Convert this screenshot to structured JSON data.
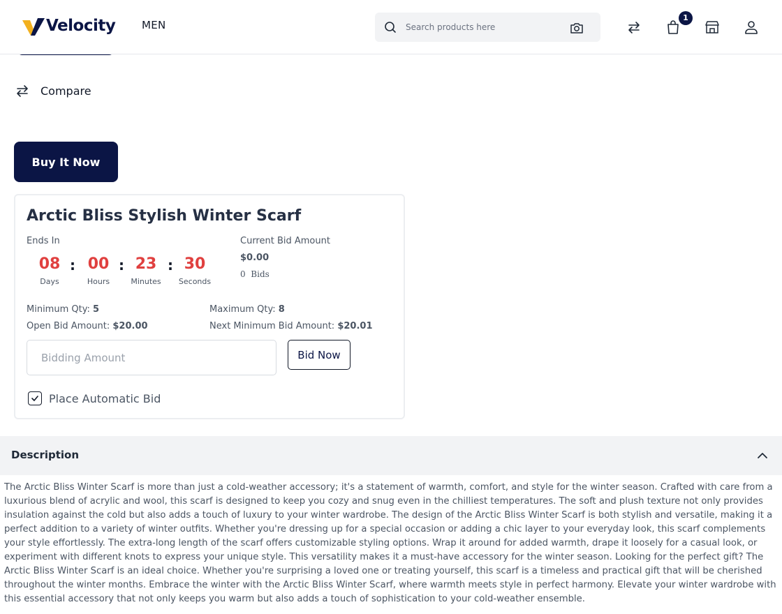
{
  "header": {
    "logo_text": "Velocity",
    "nav_men": "MEN",
    "search_placeholder": "Search products here",
    "cart_count": "1"
  },
  "actions": {
    "compare_label": "Compare",
    "buy_now_label": "Buy It Now"
  },
  "auction": {
    "title": "Arctic Bliss Stylish Winter Scarf",
    "ends_in_label": "Ends In",
    "countdown": [
      {
        "value": "08",
        "unit": "Days"
      },
      {
        "value": "00",
        "unit": "Hours"
      },
      {
        "value": "23",
        "unit": "Minutes"
      },
      {
        "value": "30",
        "unit": "Seconds"
      }
    ],
    "colon": ":",
    "current_bid_label": "Current Bid Amount",
    "current_bid_value": "$0.00",
    "bids_count": "0",
    "bids_label": "Bids",
    "min_qty_label": "Minimum Qty:",
    "min_qty_value": "5",
    "max_qty_label": "Maximum Qty:",
    "max_qty_value": "8",
    "open_bid_label": "Open Bid Amount:",
    "open_bid_value": "$20.00",
    "next_min_bid_label": "Next Minimum Bid Amount:",
    "next_min_bid_value": "$20.01",
    "bid_input_placeholder": "Bidding Amount",
    "bid_now_label": "Bid Now",
    "auto_bid_label": "Place Automatic Bid"
  },
  "description": {
    "title": "Description",
    "text": "The Arctic Bliss Winter Scarf is more than just a cold-weather accessory; it's a statement of warmth, comfort, and style for the winter season. Crafted with care from a luxurious blend of acrylic and wool, this scarf is designed to keep you cozy and snug even in the chilliest temperatures. The soft and plush texture not only provides insulation against the cold but also adds a touch of luxury to your winter wardrobe. The design of the Arctic Bliss Winter Scarf is both stylish and versatile, making it a perfect addition to a variety of winter outfits. Whether you're dressing up for a special occasion or adding a chic layer to your everyday look, this scarf complements your style effortlessly. The extra-long length of the scarf offers customizable styling options. Wrap it around for added warmth, drape it loosely for a casual look, or experiment with different knots to express your unique style. This versatility makes it a must-have accessory for the winter season. Looking for the perfect gift? The Arctic Bliss Winter Scarf is an ideal choice. Whether you're surprising a loved one or treating yourself, this scarf is a timeless and practical gift that will be cherished throughout the winter months. Embrace the winter with the Arctic Bliss Winter Scarf, where warmth meets style in perfect harmony. Elevate your winter wardrobe with this essential accessory that not only keeps you warm but also adds a touch of sophistication to your cold-weather ensemble."
  },
  "colors": {
    "brand_navy": "#0b1545",
    "logo_gold": "#f2b01e",
    "countdown_red": "#e0403f"
  },
  "icons": [
    "search-icon",
    "camera-icon",
    "compare-icon",
    "cart-icon",
    "store-icon",
    "user-icon",
    "check-icon",
    "chevron-up-icon"
  ]
}
